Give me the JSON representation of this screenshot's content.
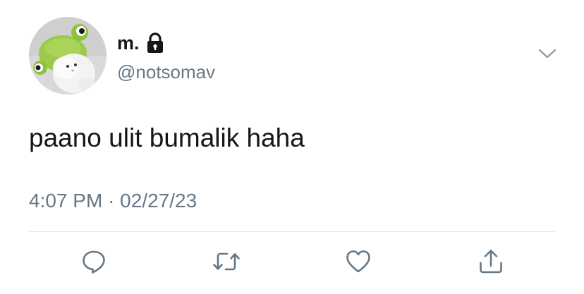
{
  "user": {
    "display_name": "m.",
    "handle": "@notsomav",
    "protected": true,
    "lock_icon": "lock-icon",
    "avatar": "avatar"
  },
  "tweet": {
    "text": "paano ulit bumalik haha",
    "time": "4:07 PM",
    "separator": "·",
    "date": "02/27/23"
  },
  "actions": [
    {
      "name": "reply",
      "icon": "speech-bubble-icon"
    },
    {
      "name": "retweet",
      "icon": "retweet-icon"
    },
    {
      "name": "like",
      "icon": "heart-icon"
    },
    {
      "name": "share",
      "icon": "share-icon"
    }
  ],
  "menu": {
    "icon": "chevron-down-icon"
  },
  "colors": {
    "text_primary": "#14171a",
    "text_secondary": "#657786",
    "icon": "#657786",
    "divider": "#e1e8ed"
  }
}
